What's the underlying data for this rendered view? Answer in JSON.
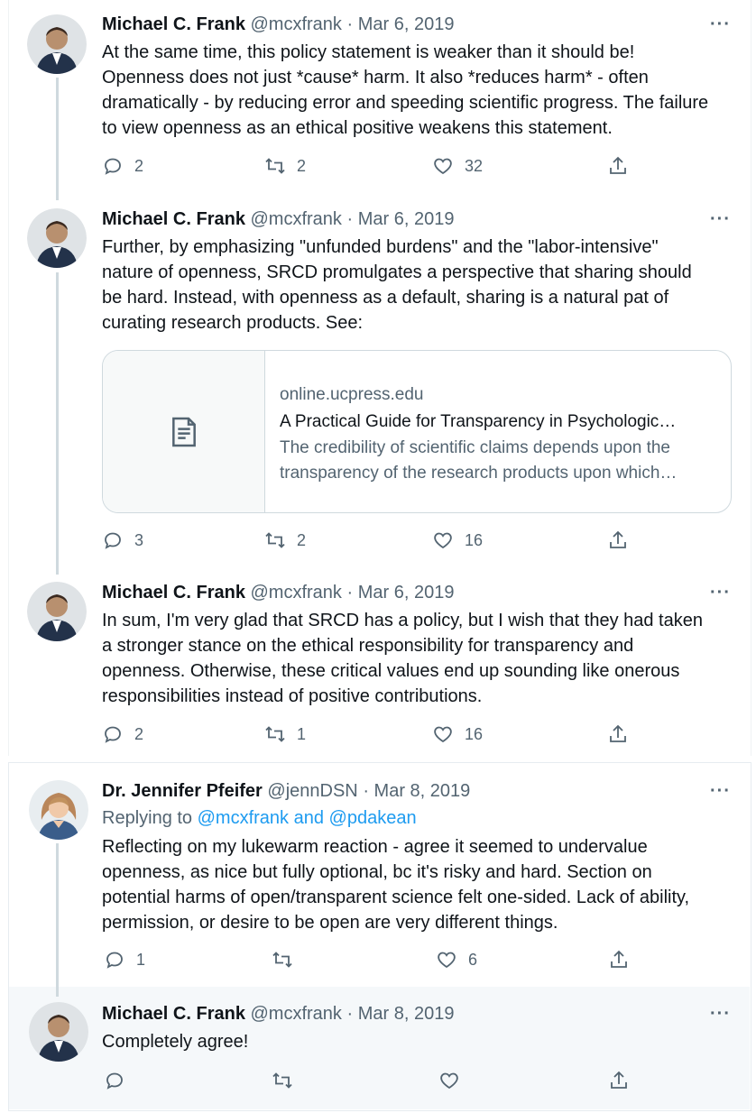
{
  "tweets": [
    {
      "author": "Michael C. Frank",
      "handle": "@mcxfrank",
      "date": "· Mar 6, 2019",
      "more": "···",
      "lines": [
        "At the same time, this policy statement is weaker than it should be!",
        "Openness does not just *cause* harm. It also *reduces harm* - often",
        "dramatically - by reducing error and speeding scientific progress. The failure",
        "to view openness as an ethical positive weakens this statement."
      ],
      "replies": "2",
      "retweets": "2",
      "likes": "32"
    },
    {
      "author": "Michael C. Frank",
      "handle": "@mcxfrank",
      "date": "· Mar 6, 2019",
      "more": "···",
      "lines": [
        "Further, by emphasizing \"unfunded burdens\" and the \"labor-intensive\"",
        "nature of openness, SRCD promulgates a perspective that sharing should",
        "be hard. Instead, with openness as a default, sharing is a natural pat of",
        "curating research products. See:"
      ],
      "card": {
        "domain": "online.ucpress.edu",
        "title": "A Practical Guide for Transparency in Psychologic…",
        "desc_lines": [
          "The credibility of scientific claims depends upon the",
          "transparency of the research products upon which…"
        ],
        "icon": "document-icon"
      },
      "replies": "3",
      "retweets": "2",
      "likes": "16"
    },
    {
      "author": "Michael C. Frank",
      "handle": "@mcxfrank",
      "date": "· Mar 6, 2019",
      "more": "···",
      "lines": [
        "In sum, I'm very glad that SRCD has a policy, but I wish that they had taken",
        "a stronger stance on the ethical responsibility for transparency and",
        "openness. Otherwise, these critical values end up sounding like onerous",
        "responsibilities instead of positive contributions."
      ],
      "replies": "2",
      "retweets": "1",
      "likes": "16"
    },
    {
      "author": "Dr. Jennifer Pfeifer",
      "handle": "@jennDSN",
      "date": "· Mar 8, 2019",
      "more": "···",
      "replying_prefix": "Replying to",
      "replying_to": "@mcxfrank and @pdakean",
      "lines": [
        "Reflecting on my lukewarm reaction - agree it seemed to undervalue",
        "openness, as nice but fully optional, bc it's risky and hard. Section on",
        "potential harms of open/transparent science felt one-sided. Lack of ability,",
        "permission, or desire to be open are very different things."
      ],
      "replies": "1",
      "retweets": "",
      "likes": "6"
    },
    {
      "author": "Michael C. Frank",
      "handle": "@mcxfrank",
      "date": "· Mar 8, 2019",
      "more": "···",
      "lines": [
        "Completely agree!"
      ],
      "replies": "",
      "retweets": "",
      "likes": ""
    }
  ],
  "colors": {
    "accent": "#1d9bf0",
    "muted": "#536471",
    "text": "#0f1419",
    "thread_line": "#cfd9de"
  }
}
